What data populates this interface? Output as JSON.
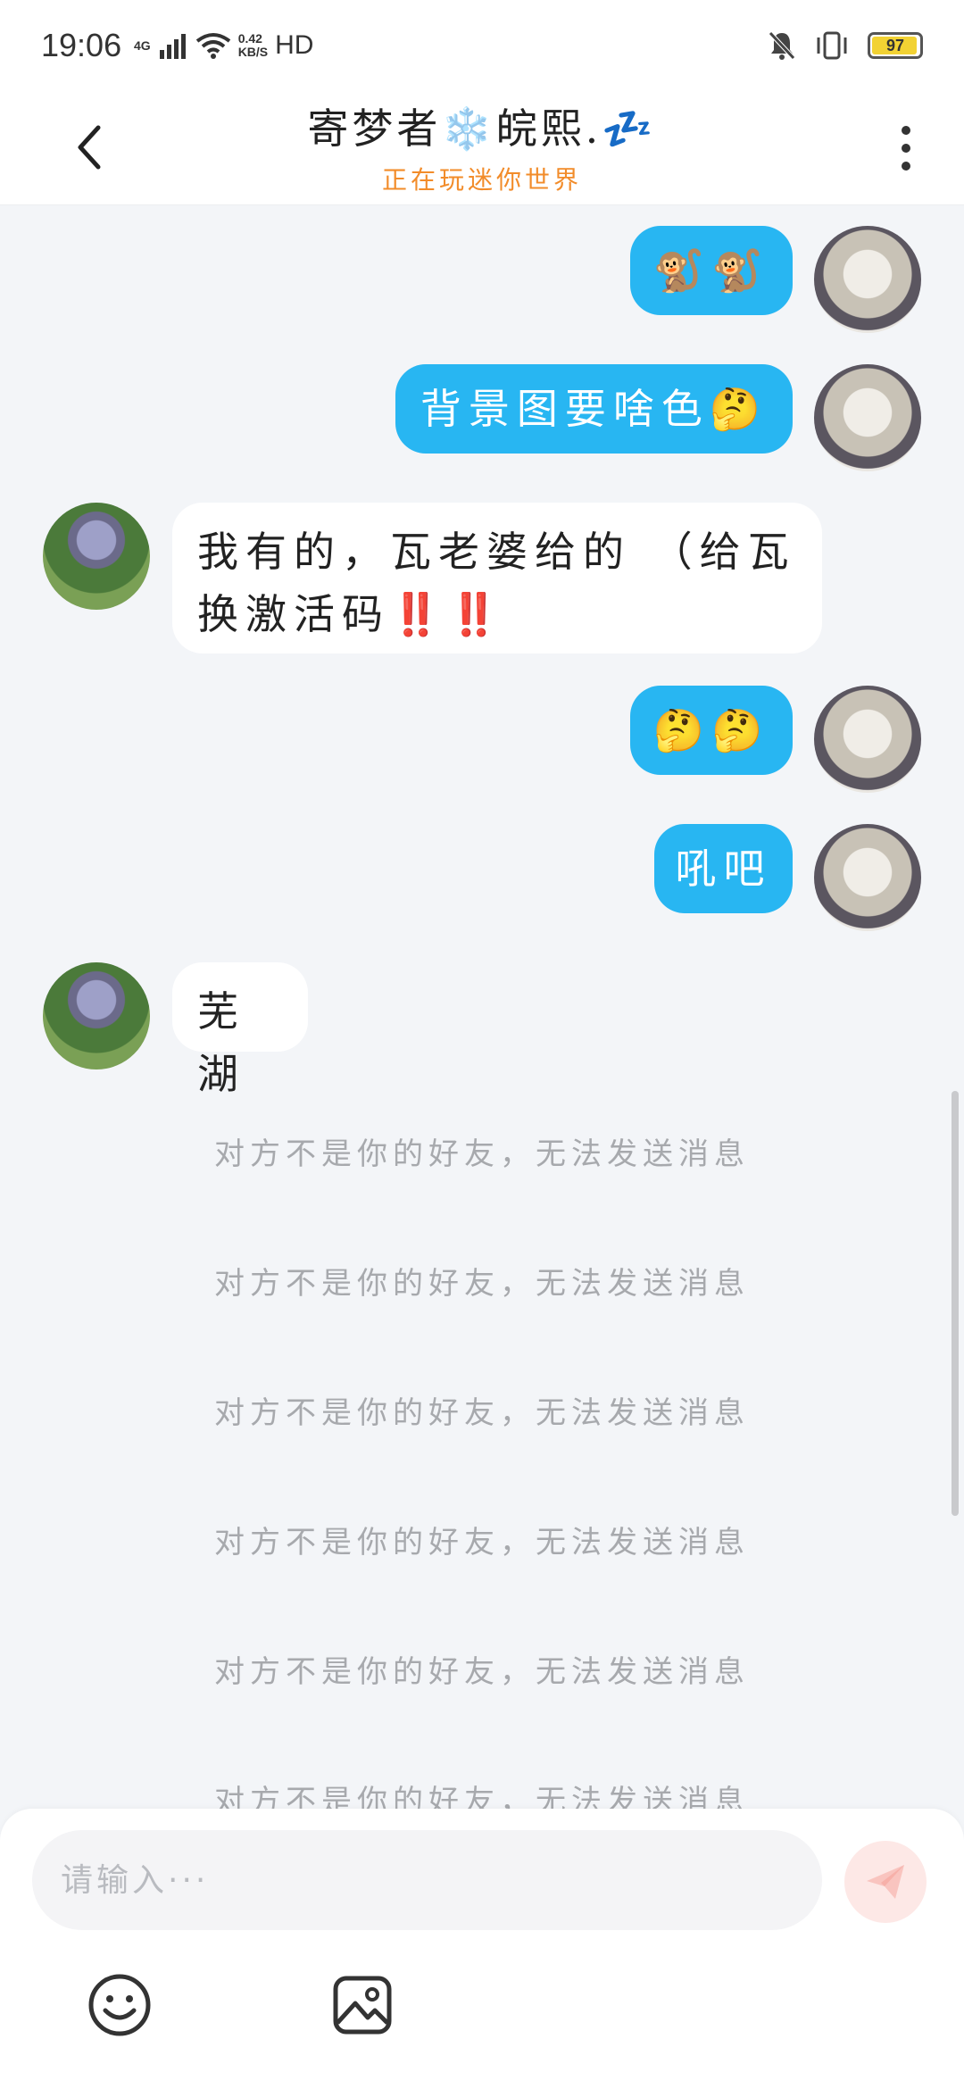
{
  "status_bar": {
    "time": "19:06",
    "network": "4G",
    "speed_value": "0.42",
    "speed_unit": "KB/S",
    "hd": "HD",
    "battery": "97",
    "battery_level": 0.97
  },
  "header": {
    "title": "寄梦者❄️皖熙.💤",
    "subtitle": "正在玩迷你世界"
  },
  "messages": [
    {
      "side": "out",
      "text": "🐒🐒"
    },
    {
      "side": "out",
      "text": "背景图要啥色🤔"
    },
    {
      "side": "in",
      "text": "我有的，瓦老婆给的 （给瓦换激活码‼️‼️"
    },
    {
      "side": "out",
      "text": "🤔🤔"
    },
    {
      "side": "out",
      "text": "吼吧"
    },
    {
      "side": "in",
      "text": "芜湖"
    }
  ],
  "system_messages": [
    "对方不是你的好友，无法发送消息",
    "对方不是你的好友，无法发送消息",
    "对方不是你的好友，无法发送消息",
    "对方不是你的好友，无法发送消息",
    "对方不是你的好友，无法发送消息",
    "对方不是你的好友，无法发送消息"
  ],
  "input": {
    "placeholder": "请输入···"
  },
  "icons": {
    "back": "chevron-left-icon",
    "more": "more-vertical-icon",
    "send": "send-icon",
    "emoji": "emoji-icon",
    "image": "image-icon"
  },
  "colors": {
    "outgoing_bubble": "#28b6f2",
    "incoming_bubble": "#ffffff",
    "background": "#f3f5f8",
    "subtitle": "#f28c2a",
    "system_text": "#a7a9ad"
  }
}
